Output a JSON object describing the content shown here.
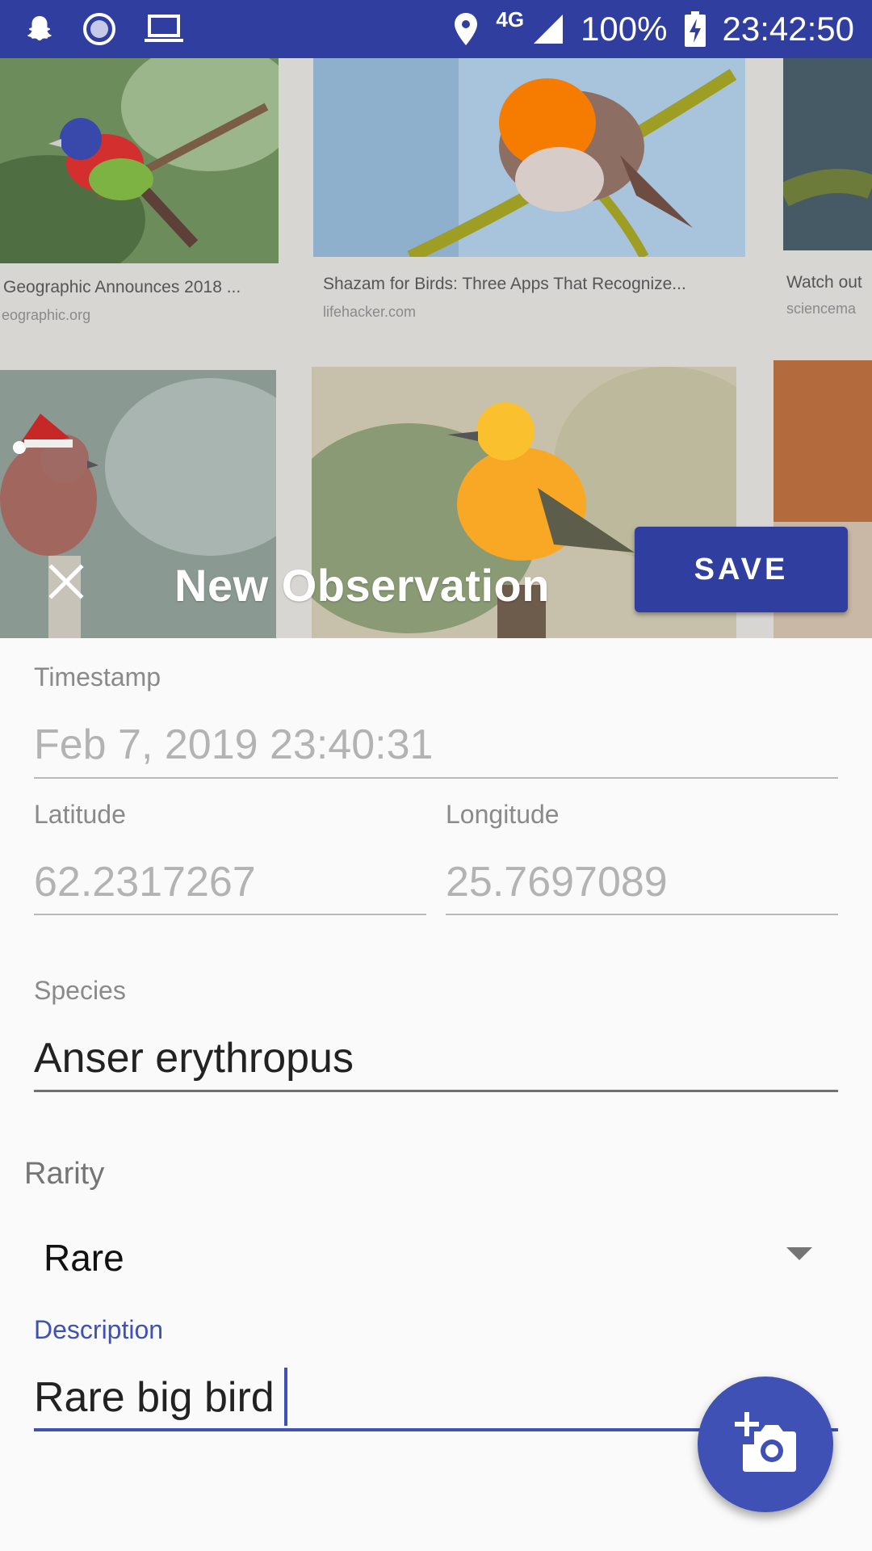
{
  "status_bar": {
    "icons": [
      "snapchat-icon",
      "sync-icon",
      "laptop-icon",
      "location-pin-icon",
      "signal-icon",
      "battery-charging-icon"
    ],
    "network": "4G",
    "battery": "100%",
    "time": "23:42:50",
    "color": "#303f9f"
  },
  "header": {
    "title": "New Observation",
    "save_label": "SAVE",
    "close_icon": "close-icon",
    "photo_captions": [
      {
        "title": "Geographic Announces 2018 ...",
        "source": "eographic.org"
      },
      {
        "title": "Shazam for Birds: Three Apps That Recognize...",
        "source": "lifehacker.com"
      },
      {
        "title": "Watch out",
        "source": "sciencema"
      }
    ]
  },
  "form": {
    "timestamp": {
      "label": "Timestamp",
      "value": "Feb 7, 2019 23:40:31"
    },
    "latitude": {
      "label": "Latitude",
      "value": "62.2317267"
    },
    "longitude": {
      "label": "Longitude",
      "value": "25.7697089"
    },
    "species": {
      "label": "Species",
      "value": "Anser erythropus"
    },
    "rarity": {
      "label": "Rarity",
      "value": "Rare"
    },
    "description": {
      "label": "Description",
      "value": "Rare big bird"
    }
  },
  "fab": {
    "icon": "add-photo-icon"
  },
  "colors": {
    "primary": "#3f51b5",
    "primary_dark": "#303f9f",
    "background": "#fafafa"
  }
}
